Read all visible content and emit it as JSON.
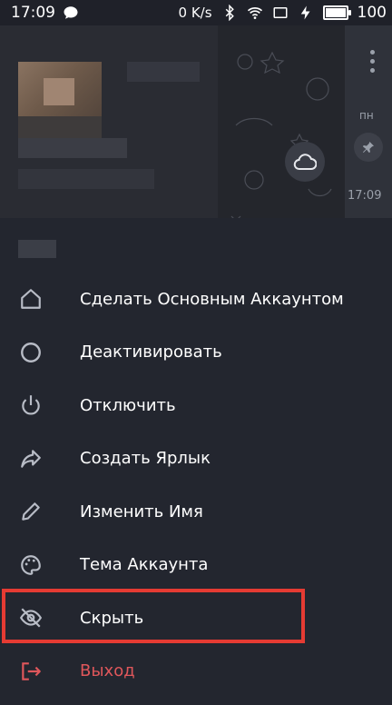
{
  "statusbar": {
    "time": "17:09",
    "speed": "0 K/s",
    "battery_level": "100"
  },
  "chat_preview": {
    "day_label": "пн",
    "time": "17:09"
  },
  "menu": {
    "items": [
      {
        "label": "Сделать Основным Аккаунтом",
        "icon": "home-icon"
      },
      {
        "label": "Деактивировать",
        "icon": "circle-icon"
      },
      {
        "label": "Отключить",
        "icon": "power-icon"
      },
      {
        "label": "Создать Ярлык",
        "icon": "share-arrow-icon"
      },
      {
        "label": "Изменить Имя",
        "icon": "pencil-icon"
      },
      {
        "label": "Тема Аккаунта",
        "icon": "palette-icon"
      },
      {
        "label": "Скрыть",
        "icon": "eye-off-icon"
      },
      {
        "label": "Выход",
        "icon": "logout-icon"
      }
    ]
  },
  "colors": {
    "background": "#23262f",
    "text": "#ffffff",
    "danger": "#e0575b",
    "highlight": "#e53b33",
    "icon": "#b8bcc6"
  }
}
